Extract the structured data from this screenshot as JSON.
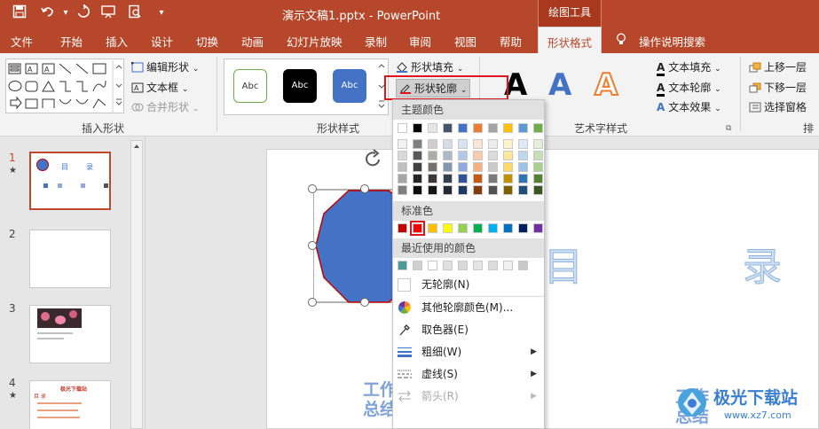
{
  "window": {
    "title": "演示文稿1.pptx  -  PowerPoint",
    "context_tab_title": "绘图工具"
  },
  "tabs": [
    {
      "label": "文件"
    },
    {
      "label": "开始"
    },
    {
      "label": "插入"
    },
    {
      "label": "设计"
    },
    {
      "label": "切换"
    },
    {
      "label": "动画"
    },
    {
      "label": "幻灯片放映"
    },
    {
      "label": "录制"
    },
    {
      "label": "审阅"
    },
    {
      "label": "视图"
    },
    {
      "label": "帮助"
    },
    {
      "label": "形状格式"
    }
  ],
  "tell_me": "操作说明搜索",
  "ribbon": {
    "insert_shapes": {
      "label": "插入形状",
      "edit_shape": "编辑形状",
      "text_box": "文本框",
      "merge_shapes": "合并形状"
    },
    "shape_styles": {
      "label": "形状样式",
      "sample_text": "Abc",
      "fill": "形状填充",
      "outline": "形状轮廓"
    },
    "wordart": {
      "label": "艺术字样式",
      "text_fill": "文本填充",
      "text_outline": "文本轮廓",
      "text_effects": "文本效果"
    },
    "arrange": {
      "label": "排",
      "bring_forward": "上移一层",
      "send_backward": "下移一层",
      "selection_pane": "选择窗格"
    }
  },
  "slides": [
    {
      "number": "1",
      "title1": "目",
      "title2": "录"
    },
    {
      "number": "2"
    },
    {
      "number": "3"
    },
    {
      "number": "4",
      "heading": "极光下载站",
      "sub": "目 录"
    }
  ],
  "slide": {
    "text_mu": "目",
    "text_lu": "录",
    "bottom_left": "工作总结",
    "bottom_mid": "总结",
    "bottom_right": "工作总结"
  },
  "outline_menu": {
    "theme_colors_label": "主题颜色",
    "standard_colors_label": "标准色",
    "recent_colors_label": "最近使用的颜色",
    "no_outline": "无轮廓(N)",
    "more_colors": "其他轮廓颜色(M)...",
    "eyedropper": "取色器(E)",
    "weight": "粗细(W)",
    "dashes": "虚线(S)",
    "arrows": "箭头(R)",
    "theme_top_row": [
      "#ffffff",
      "#000000",
      "#e7e6e6",
      "#44546a",
      "#4472c4",
      "#ed7d31",
      "#a5a5a5",
      "#ffc000",
      "#5b9bd5",
      "#70ad47"
    ],
    "theme_shades": [
      [
        "#f2f2f2",
        "#7f7f7f",
        "#d0cece",
        "#d6dce5",
        "#d9e2f3",
        "#fbe5d6",
        "#ededed",
        "#fff2cc",
        "#deebf7",
        "#e2f0d9"
      ],
      [
        "#d9d9d9",
        "#595959",
        "#aeabab",
        "#adb9ca",
        "#b4c7e7",
        "#f8cbad",
        "#dbdbdb",
        "#ffe699",
        "#bdd7ee",
        "#c5e0b4"
      ],
      [
        "#bfbfbf",
        "#404040",
        "#757171",
        "#8497b0",
        "#8faadc",
        "#f4b183",
        "#c9c9c9",
        "#ffd966",
        "#9dc3e6",
        "#a9d18e"
      ],
      [
        "#a6a6a6",
        "#262626",
        "#3a3838",
        "#333f50",
        "#2f5597",
        "#c55a11",
        "#7b7b7b",
        "#bf9000",
        "#2e75b6",
        "#548235"
      ],
      [
        "#7f7f7f",
        "#0d0d0d",
        "#171616",
        "#222a35",
        "#1f3864",
        "#843c0c",
        "#525252",
        "#7f6000",
        "#1f4e79",
        "#385723"
      ]
    ],
    "standard": [
      "#c00000",
      "#ff0000",
      "#ffc000",
      "#ffff00",
      "#92d050",
      "#00b050",
      "#00b0f0",
      "#0070c0",
      "#002060",
      "#7030a0"
    ],
    "recent": [
      "#4a9a9a",
      "#d0d0d0",
      "#ffffff",
      "#e0e0e0",
      "#d8d8d8",
      "#e4e4e4",
      "#dcdcdc",
      "#f0f0f0",
      "#c8c8c8"
    ]
  },
  "colors": {
    "accent": "#b7472a",
    "highlight_box": "#e0141e",
    "shape_fill": "#4472c4",
    "shape_outline": "#c00000"
  },
  "watermark": {
    "text": "极光下载站",
    "url": "www.xz7.com"
  }
}
